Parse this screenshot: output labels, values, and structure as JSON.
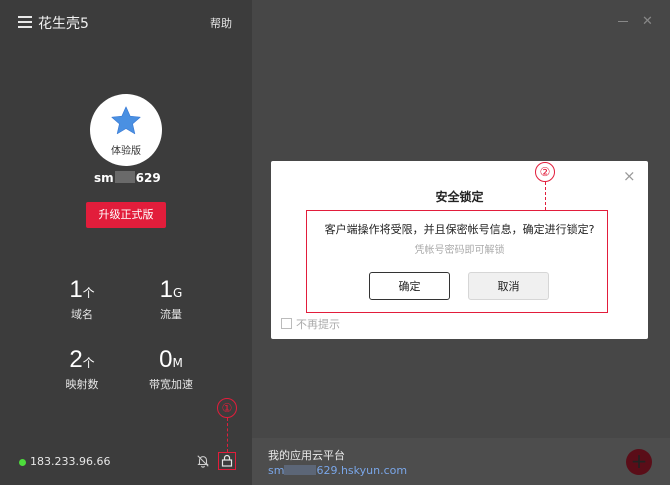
{
  "app": {
    "title": "花生壳5",
    "help": "帮助"
  },
  "profile": {
    "avatar_label": "体验版",
    "username_prefix": "sm",
    "username_suffix": "629",
    "upgrade_button": "升级正式版"
  },
  "stats": [
    {
      "value": "1",
      "unit": "个",
      "label": "域名"
    },
    {
      "value": "1",
      "unit": "G",
      "label": "流量"
    },
    {
      "value": "2",
      "unit": "个",
      "label": "映射数"
    },
    {
      "value": "0",
      "unit": "M",
      "label": "带宽加速"
    }
  ],
  "status": {
    "ip": "183.233.96.66",
    "online_color": "#4ddc3c"
  },
  "annotations": {
    "one": "①",
    "two": "②"
  },
  "cloud": {
    "title": "我的应用云平台",
    "url_prefix": "sm",
    "url_suffix": "629.hskyun.com"
  },
  "add_button": "+",
  "dialog": {
    "title": "安全锁定",
    "message": "客户端操作将受限，并且保密帐号信息，确定进行锁定?",
    "sub": "凭帐号密码即可解锁",
    "ok": "确定",
    "cancel": "取消",
    "dont_remind": "不再提示",
    "close": "×"
  },
  "accent_color": "#e21d3b"
}
